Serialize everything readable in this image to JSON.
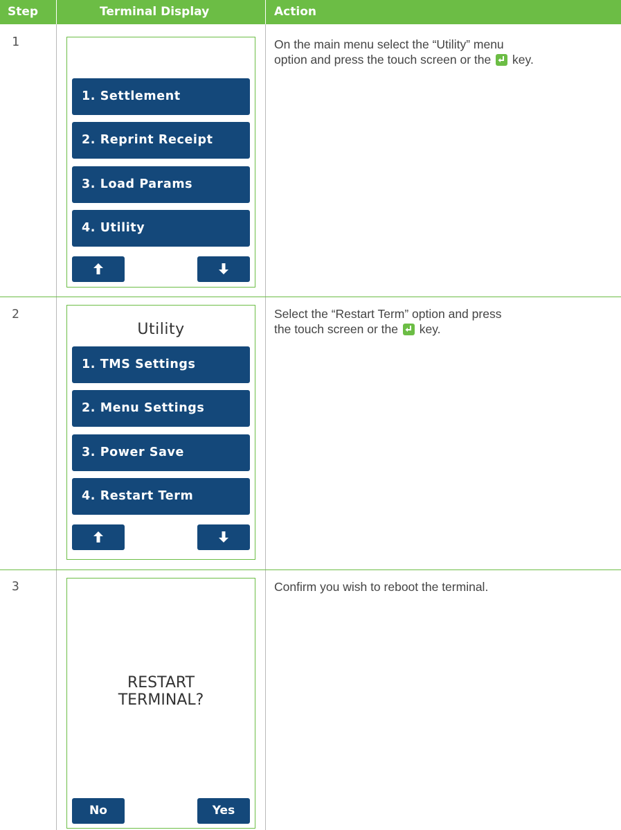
{
  "header": {
    "step": "Step",
    "terminal_display": "Terminal Display",
    "action": "Action"
  },
  "rows": [
    {
      "step": "1",
      "screen": {
        "buttons": [
          "1. Settlement",
          "2. Reprint Receipt",
          "3. Load Params",
          "4. Utility"
        ]
      },
      "action": {
        "line1": "On the main menu select the “Utility” menu",
        "line2_before": "option and press the touch screen or the",
        "line2_after": "key."
      }
    },
    {
      "step": "2",
      "screen": {
        "title": "Utility",
        "buttons": [
          "1. TMS Settings",
          "2. Menu Settings",
          "3. Power Save",
          "4. Restart Term"
        ]
      },
      "action": {
        "line1": "Select the “Restart Term” option and press",
        "line2_before": "the touch screen or the",
        "line2_after": "key."
      }
    },
    {
      "step": "3",
      "screen": {
        "message_line1": "RESTART",
        "message_line2": "TERMINAL?",
        "no_label": "No",
        "yes_label": "Yes"
      },
      "action": {
        "line1": "Confirm you wish to reboot the terminal."
      }
    }
  ],
  "icons": {
    "up": "up-arrow-icon",
    "down": "down-arrow-icon",
    "enter": "enter-key-icon"
  },
  "colors": {
    "header_green": "#6cbd45",
    "button_blue": "#14487a",
    "enter_key_green": "#6cbd45"
  }
}
